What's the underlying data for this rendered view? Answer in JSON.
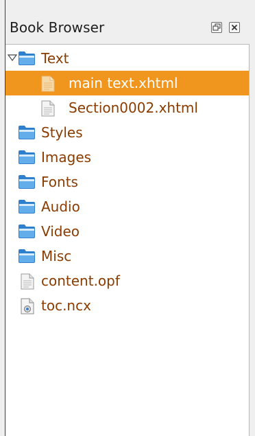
{
  "panel": {
    "title": "Book Browser"
  },
  "tree": {
    "items": [
      {
        "label": "Text",
        "icon": "folder-icon",
        "expanded": true,
        "level": 0
      },
      {
        "label": "main text.xhtml",
        "icon": "file-icon",
        "selected": true,
        "level": 1
      },
      {
        "label": "Section0002.xhtml",
        "icon": "file-icon",
        "level": 1
      },
      {
        "label": "Styles",
        "icon": "folder-icon",
        "level": 0
      },
      {
        "label": "Images",
        "icon": "folder-icon",
        "level": 0
      },
      {
        "label": "Fonts",
        "icon": "folder-icon",
        "level": 0
      },
      {
        "label": "Audio",
        "icon": "folder-icon",
        "level": 0
      },
      {
        "label": "Video",
        "icon": "folder-icon",
        "level": 0
      },
      {
        "label": "Misc",
        "icon": "folder-icon",
        "level": 0
      },
      {
        "label": "content.opf",
        "icon": "file-icon",
        "level": 0
      },
      {
        "label": "toc.ncx",
        "icon": "ncx-file-icon",
        "level": 0
      }
    ]
  },
  "colors": {
    "selection": "#f0961e",
    "item_text": "#8a3c00",
    "folder_blue": "#3f8fd8"
  }
}
